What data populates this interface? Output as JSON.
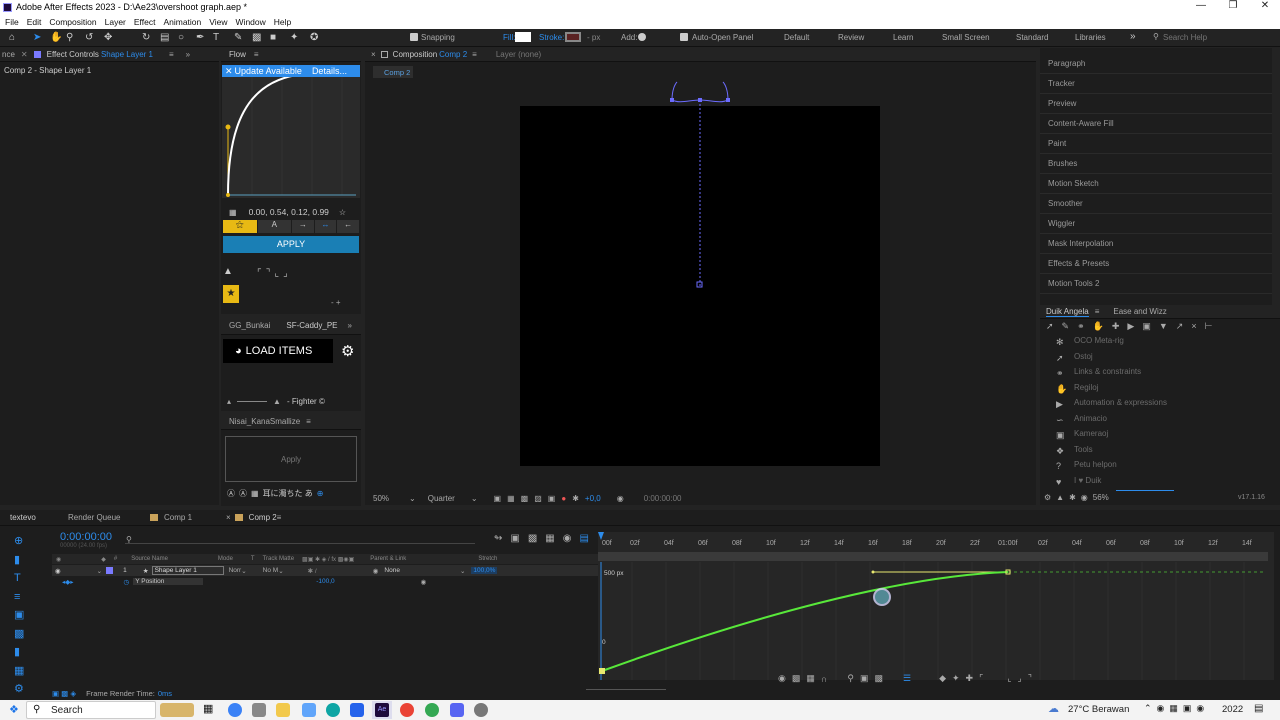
{
  "window": {
    "title": "Adobe After Effects 2023 - D:\\Ae23\\overshoot graph.aep *"
  },
  "menu": [
    "File",
    "Edit",
    "Composition",
    "Layer",
    "Effect",
    "Animation",
    "View",
    "Window",
    "Help"
  ],
  "toolbar": {
    "snapping": "Snapping",
    "fill": "Fill:",
    "stroke": "Stroke:",
    "px": "- px",
    "add": "Add:",
    "auto_open": "Auto-Open Panel",
    "workspaces": [
      "Default",
      "Review",
      "Learn",
      "Small Screen",
      "Standard",
      "Libraries"
    ],
    "search_placeholder": "Search Help"
  },
  "left_panel": {
    "tab_prefix": "nce",
    "tab": "Effect Controls",
    "tab_layer": "Shape Layer 1",
    "breadcrumb": "Comp 2 - Shape Layer 1"
  },
  "flow": {
    "title": "Flow",
    "update": "Update Available",
    "details": "Details...",
    "values": "0.00, 0.54, 0.12, 0.99",
    "apply": "APPLY",
    "tabs": [
      "GG_Bunkai",
      "SF-Caddy_PE"
    ],
    "load_items": "LOAD ITEMS",
    "fighter": "- Fighter ©",
    "nisai": "Nisai_KanaSmallize",
    "nisai_apply": "Apply",
    "nisai_btn": "耳に濁ちた あ"
  },
  "composition": {
    "tab": "Composition",
    "comp": "Comp 2",
    "layer": "Layer (none)",
    "subtab": "Comp 2",
    "zoom": "50%",
    "quality": "Quarter",
    "exposure": "+0,0",
    "time": "0:00:00:00"
  },
  "right_panel": {
    "items": [
      "Paragraph",
      "Tracker",
      "Preview",
      "Content-Aware Fill",
      "Paint",
      "Brushes",
      "Motion Sketch",
      "Smoother",
      "Wiggler",
      "Mask Interpolation",
      "Effects & Presets",
      "Motion Tools 2"
    ],
    "duik_tabs": [
      "Duik Angela",
      "Ease and Wizz"
    ],
    "duik_items": [
      "OCO Meta-rig",
      "Ostoj",
      "Links & constraints",
      "Regiloj",
      "Automation & expressions",
      "Animacio",
      "Kameraoj",
      "Tools",
      "Petu helpon",
      "I ♥ Duik"
    ],
    "duik_percent": "56%",
    "version": "v17.1.16"
  },
  "timeline": {
    "tabs": [
      "textevo",
      "Render Queue",
      "Comp 1",
      "Comp 2"
    ],
    "timecode": "0:00:00:00",
    "fps": "00000 (24.00 fps)",
    "columns": [
      "Source Name",
      "Mode",
      "T",
      "Track Matte",
      "Parent & Link",
      "Stretch"
    ],
    "layer": {
      "num": "1",
      "name": "Shape Layer 1",
      "mode": "Norr",
      "matte": "No M",
      "parent": "None",
      "stretch": "100,0%"
    },
    "property": {
      "name": "Y Position",
      "value": "-100,0"
    },
    "ruler": [
      "00f",
      "02f",
      "04f",
      "06f",
      "08f",
      "10f",
      "12f",
      "14f",
      "16f",
      "18f",
      "20f",
      "22f",
      "01:00f",
      "02f",
      "04f",
      "06f",
      "08f",
      "10f",
      "12f",
      "14f"
    ],
    "graph_top": "500 px",
    "graph_zero": "0",
    "render_time_label": "Frame Render Time:",
    "render_time": "0ms"
  },
  "taskbar": {
    "search": "Search",
    "weather": "27°C  Berawan",
    "time": "2022"
  },
  "colors": {
    "accent": "#2d8ceb",
    "flow_yellow": "#e8b914",
    "apply_blue": "#1a7fb5",
    "graph": "#58e83a"
  }
}
